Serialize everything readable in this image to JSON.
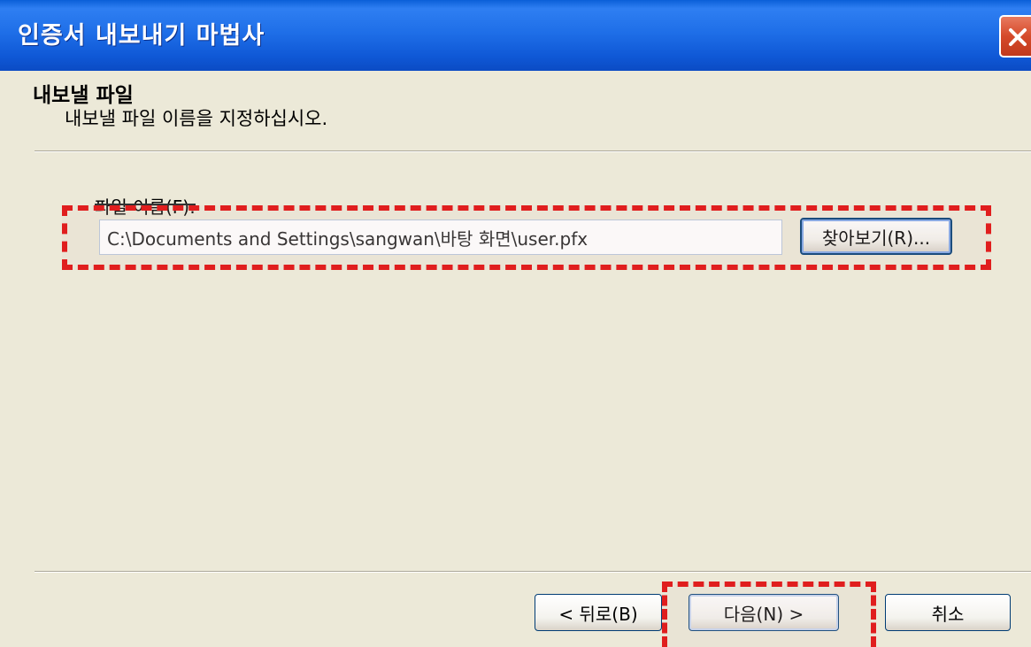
{
  "window": {
    "title": "인증서 내보내기 마법사"
  },
  "header": {
    "title": "내보낼 파일",
    "subtitle": "내보낼 파일 이름을 지정하십시오."
  },
  "file_name": {
    "label": "파일 이름(F):",
    "value": "C:\\Documents and Settings\\sangwan\\바탕 화면\\user.pfx",
    "browse_button": "찾아보기(R)..."
  },
  "footer": {
    "back_button": "< 뒤로(B)",
    "next_button": "다음(N) >",
    "cancel_button": "취소"
  },
  "colors": {
    "titlebar": "#1f6fe8",
    "dialog_bg": "#ece9d8",
    "highlight": "#e01e1e"
  },
  "icons": {
    "close": "close-icon"
  }
}
